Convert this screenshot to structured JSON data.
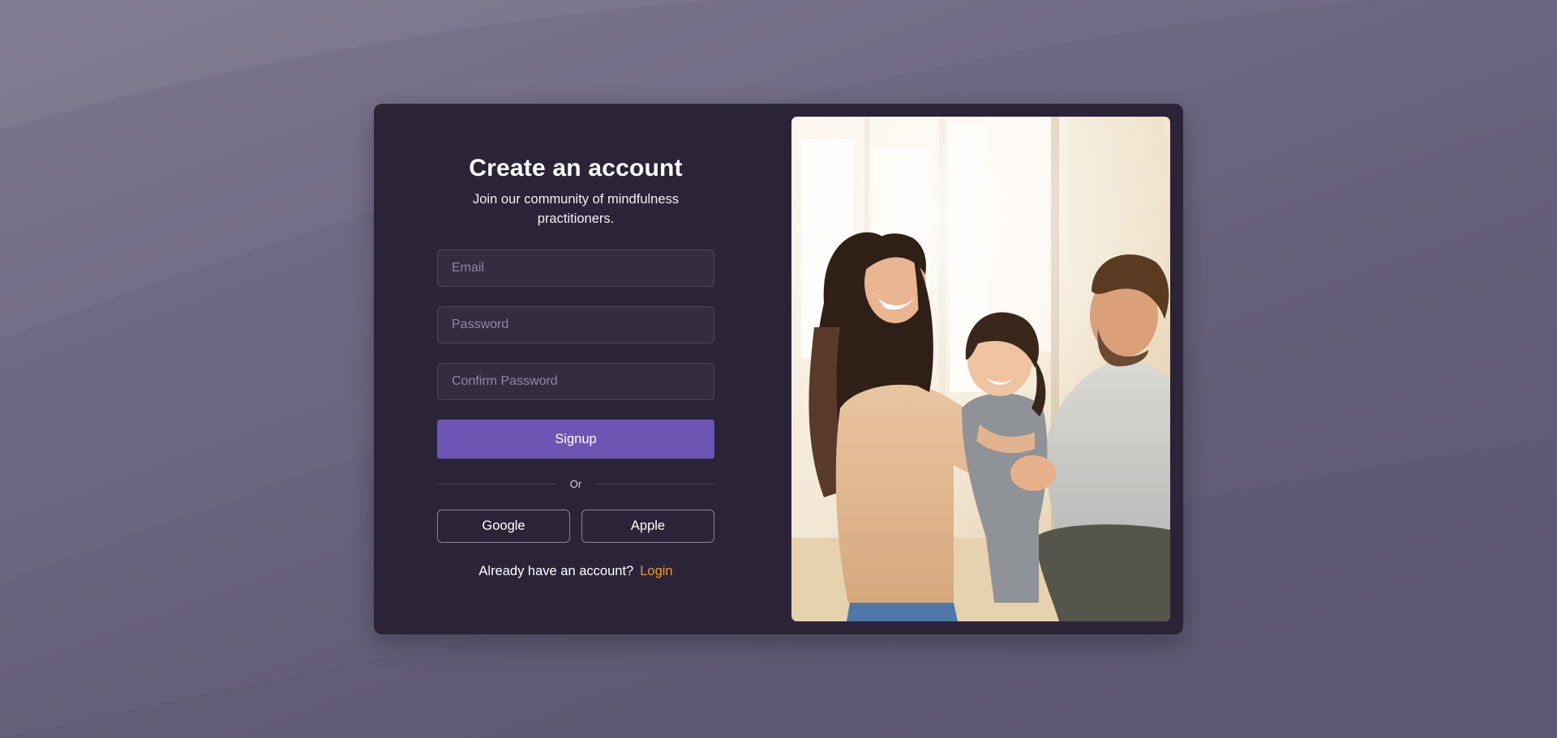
{
  "signup_form": {
    "title": "Create an account",
    "subtitle": "Join our community of mindfulness practitioners.",
    "email_placeholder": "Email",
    "password_placeholder": "Password",
    "confirm_password_placeholder": "Confirm Password",
    "signup_label": "Signup",
    "divider_label": "Or",
    "google_label": "Google",
    "apple_label": "Apple",
    "login_prompt": "Already have an account?",
    "login_label": "Login"
  },
  "colors": {
    "background": "#6a6580",
    "card": "#2b2438",
    "field_background": "#342d42",
    "accent_button": "#6d55b4",
    "login_link": "#f39a2e"
  }
}
